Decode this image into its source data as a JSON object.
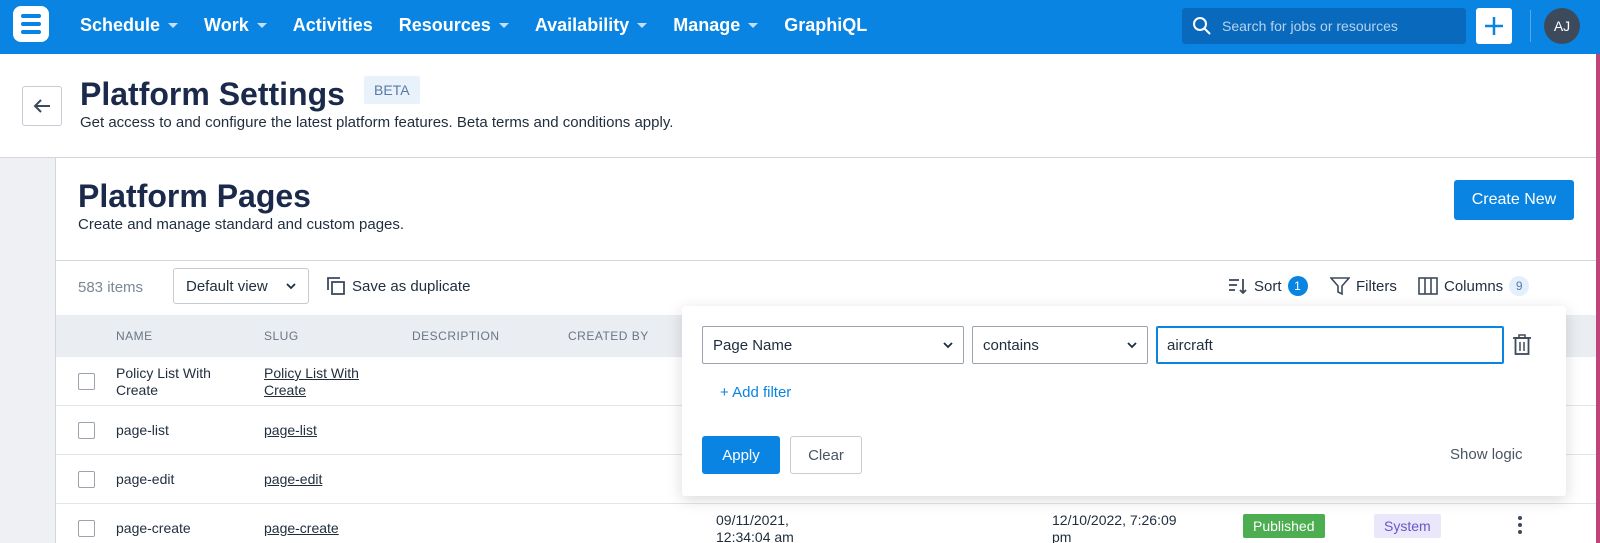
{
  "nav": {
    "items": [
      {
        "label": "Schedule",
        "dropdown": true
      },
      {
        "label": "Work",
        "dropdown": true
      },
      {
        "label": "Activities",
        "dropdown": false
      },
      {
        "label": "Resources",
        "dropdown": true
      },
      {
        "label": "Availability",
        "dropdown": true
      },
      {
        "label": "Manage",
        "dropdown": true
      },
      {
        "label": "GraphiQL",
        "dropdown": false
      }
    ],
    "search_placeholder": "Search for jobs or resources",
    "avatar_initials": "AJ"
  },
  "header": {
    "title": "Platform Settings",
    "badge": "BETA",
    "subtitle": "Get access to and configure the latest platform features. Beta terms and conditions apply."
  },
  "section": {
    "title": "Platform Pages",
    "subtitle": "Create and manage standard and custom pages.",
    "create_label": "Create New"
  },
  "toolbar": {
    "count": "583 items",
    "view_label": "Default view",
    "duplicate_label": "Save as duplicate",
    "sort_label": "Sort",
    "sort_count": "1",
    "filters_label": "Filters",
    "columns_label": "Columns",
    "columns_count": "9"
  },
  "table": {
    "headers": {
      "name": "NAME",
      "slug": "SLUG",
      "description": "DESCRIPTION",
      "created_by": "CREATED BY"
    },
    "rows": [
      {
        "name": "Policy List With Create",
        "slug": "Policy List With Create"
      },
      {
        "name": "page-list",
        "slug": "page-list"
      },
      {
        "name": "page-edit",
        "slug": "page-edit"
      },
      {
        "name": "page-create",
        "slug": "page-create",
        "created": "09/11/2021, 12:34:04 am",
        "updated": "12/10/2022, 7:26:09 pm",
        "status": "Published",
        "type": "System"
      }
    ]
  },
  "filter": {
    "field": "Page Name",
    "operator": "contains",
    "value": "aircraft",
    "add_label": "+ Add filter",
    "apply_label": "Apply",
    "clear_label": "Clear",
    "logic_label": "Show logic"
  },
  "colors": {
    "primary": "#0a84e3",
    "published": "#4cae50",
    "system_bg": "#ebe7fb"
  }
}
